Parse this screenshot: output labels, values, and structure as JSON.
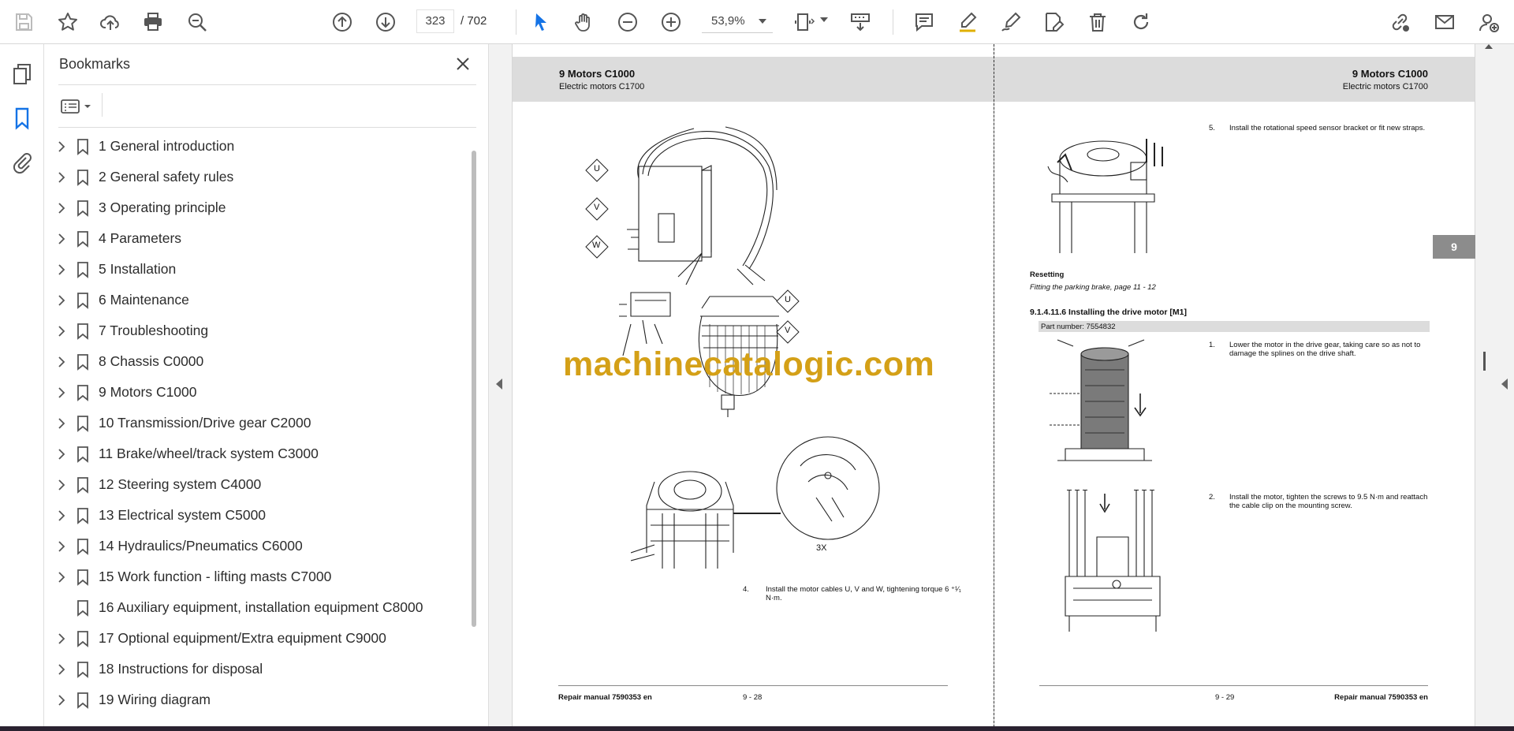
{
  "toolbar": {
    "current_page": "323",
    "total_pages": "/ 702",
    "zoom": "53,9%"
  },
  "bookmarks_panel": {
    "title": "Bookmarks",
    "items": [
      {
        "label": "1 General introduction",
        "expandable": true
      },
      {
        "label": "2 General safety rules",
        "expandable": true
      },
      {
        "label": "3 Operating principle",
        "expandable": true
      },
      {
        "label": "4 Parameters",
        "expandable": true
      },
      {
        "label": "5 Installation",
        "expandable": true
      },
      {
        "label": "6 Maintenance",
        "expandable": true
      },
      {
        "label": "7 Troubleshooting",
        "expandable": true
      },
      {
        "label": "8 Chassis C0000",
        "expandable": true
      },
      {
        "label": "9 Motors C1000",
        "expandable": true
      },
      {
        "label": "10 Transmission/Drive gear C2000",
        "expandable": true
      },
      {
        "label": "11 Brake/wheel/track system C3000",
        "expandable": true
      },
      {
        "label": "12 Steering system C4000",
        "expandable": true
      },
      {
        "label": "13 Electrical system C5000",
        "expandable": true
      },
      {
        "label": "14 Hydraulics/Pneumatics C6000",
        "expandable": true
      },
      {
        "label": "15 Work function - lifting masts C7000",
        "expandable": true
      },
      {
        "label": "16 Auxiliary equipment, installation equipment C8000",
        "expandable": false
      },
      {
        "label": "17 Optional equipment/Extra equipment C9000",
        "expandable": true
      },
      {
        "label": "18 Instructions for disposal",
        "expandable": true
      },
      {
        "label": "19 Wiring diagram",
        "expandable": true
      }
    ]
  },
  "document": {
    "left_page": {
      "header_title": "9 Motors C1000",
      "header_sub": "Electric motors C1700",
      "label_u1": "U",
      "label_v1": "V",
      "label_w1": "W",
      "label_u2": "U",
      "label_v2": "V",
      "label_3x": "3X",
      "step4_num": "4.",
      "step4_text": "Install the motor cables U, V and W, tightening torque 6 ⁺¹⁄₁",
      "step4_text2": "N·m.",
      "footer_left": "Repair manual 7590353 en",
      "footer_center": "9 - 28"
    },
    "right_page": {
      "header_title": "9 Motors C1000",
      "header_sub": "Electric motors C1700",
      "step5_num": "5.",
      "step5_text": "Install the rotational speed sensor bracket or fit new straps.",
      "tab": "9",
      "resetting_label": "Resetting",
      "resetting_ref": "Fitting the parking brake, page 11 - 12",
      "section_title": "9.1.4.11.6 Installing the drive motor [M1]",
      "part_number": "Part number: 7554832",
      "step1_num": "1.",
      "step1_text": "Lower the motor in the drive gear, taking care so as not to",
      "step1_text2": "damage the splines on the drive shaft.",
      "step2_num": "2.",
      "step2_text": "Install the motor, tighten the screws to 9.5 N·m and reattach",
      "step2_text2": "the cable clip on the mounting screw.",
      "footer_center": "9 - 29",
      "footer_right": "Repair manual 7590353 en"
    },
    "watermark": "machinecatalogic.com"
  },
  "colors": {
    "accent": "#1473e6",
    "watermark": "#d4a017",
    "header_band": "#dcdcdc"
  }
}
